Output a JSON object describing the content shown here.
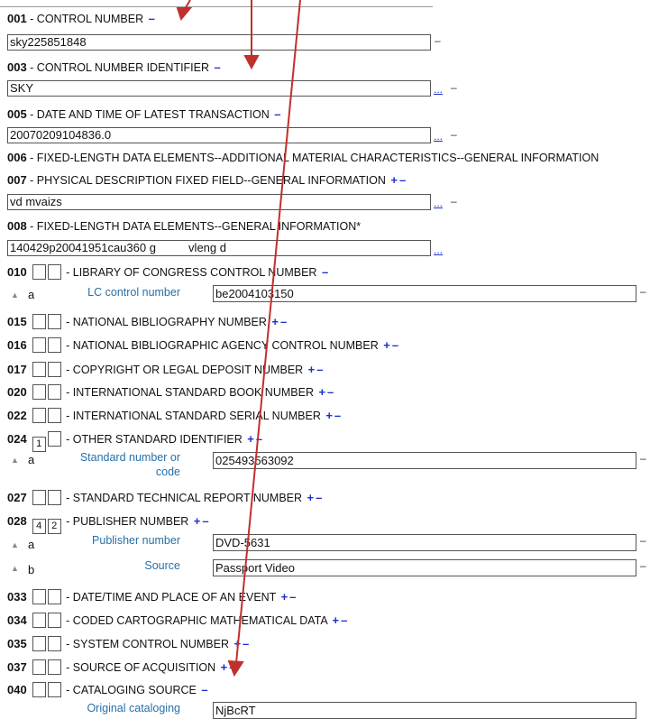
{
  "f001": {
    "tag": "001",
    "title": " - CONTROL NUMBER ",
    "minus": "–",
    "value": "sky225851848",
    "dash": "–"
  },
  "f003": {
    "tag": "003",
    "title": " - CONTROL NUMBER IDENTIFIER ",
    "minus": "–",
    "value": "SKY",
    "ellipsis": "...",
    "dash": "–"
  },
  "f005": {
    "tag": "005",
    "title": " - DATE AND TIME OF LATEST TRANSACTION ",
    "minus": "–",
    "value": "20070209104836.0",
    "ellipsis": "...",
    "dash": "–"
  },
  "f006": {
    "tag": "006",
    "title": " - FIXED-LENGTH DATA ELEMENTS--ADDITIONAL MATERIAL CHARACTERISTICS--GENERAL INFORMATION"
  },
  "f007": {
    "tag": "007",
    "title": " - PHYSICAL DESCRIPTION FIXED FIELD--GENERAL INFORMATION ",
    "plus": "+",
    "minus": "–",
    "value": "vd mvaizs",
    "ellipsis": "...",
    "dash": "–"
  },
  "f008": {
    "tag": "008",
    "title": " - FIXED-LENGTH DATA ELEMENTS--GENERAL INFORMATION*",
    "value": "140429p20041951cau360 g          vleng d",
    "ellipsis": "..."
  },
  "f010": {
    "tag": "010",
    "title": " - LIBRARY OF CONGRESS CONTROL NUMBER ",
    "minus": "–",
    "ind1": "",
    "ind2": "",
    "sub_a": {
      "arrow": "▲",
      "code": "a",
      "label": "LC control number",
      "value": "be2004103150",
      "dash": "–"
    }
  },
  "f015": {
    "tag": "015",
    "title": " - NATIONAL BIBLIOGRAPHY NUMBER ",
    "plus": "+",
    "minus": "–"
  },
  "f016": {
    "tag": "016",
    "title": " - NATIONAL BIBLIOGRAPHIC AGENCY CONTROL NUMBER ",
    "plus": "+",
    "minus": "–"
  },
  "f017": {
    "tag": "017",
    "title": " - COPYRIGHT OR LEGAL DEPOSIT NUMBER ",
    "plus": "+",
    "minus": "–"
  },
  "f020": {
    "tag": "020",
    "title": " - INTERNATIONAL STANDARD BOOK NUMBER ",
    "plus": "+",
    "minus": "–"
  },
  "f022": {
    "tag": "022",
    "title": " - INTERNATIONAL STANDARD SERIAL NUMBER ",
    "plus": "+",
    "minus": "–"
  },
  "f024": {
    "tag": "024",
    "title": " - OTHER STANDARD IDENTIFIER ",
    "plus": "+",
    "minus": "–",
    "ind1": "1",
    "ind2": "",
    "sub_a": {
      "arrow": "▲",
      "code": "a",
      "label1": "Standard number or",
      "label2": "code",
      "value": "025493563092",
      "dash": "–"
    }
  },
  "f027": {
    "tag": "027",
    "title": " - STANDARD TECHNICAL REPORT NUMBER ",
    "plus": "+",
    "minus": "–"
  },
  "f028": {
    "tag": "028",
    "title": " - PUBLISHER NUMBER ",
    "plus": "+",
    "minus": "–",
    "ind1": "4",
    "ind2": "2",
    "sub_a": {
      "arrow": "▲",
      "code": "a",
      "label": "Publisher number",
      "value": "DVD-5631",
      "dash": "–"
    },
    "sub_b": {
      "arrow": "▲",
      "code": "b",
      "label": "Source",
      "value": "Passport Video",
      "dash": "–"
    }
  },
  "f033": {
    "tag": "033",
    "title": " - DATE/TIME AND PLACE OF AN EVENT ",
    "plus": "+",
    "minus": "–"
  },
  "f034": {
    "tag": "034",
    "title": " - CODED CARTOGRAPHIC MATHEMATICAL DATA ",
    "plus": "+",
    "minus": "–"
  },
  "f035": {
    "tag": "035",
    "title": " - SYSTEM CONTROL NUMBER ",
    "plus": "+",
    "minus": "–"
  },
  "f037": {
    "tag": "037",
    "title": " - SOURCE OF ACQUISITION ",
    "plus": "+",
    "minus": "–"
  },
  "f040": {
    "tag": "040",
    "title": " - CATALOGING SOURCE ",
    "minus": "–",
    "sub_a": {
      "label": "Original cataloging",
      "value": "NjBcRT"
    }
  },
  "colors": {
    "link": "#1a2fd0",
    "label": "#2670a8",
    "arrow": "#c0302c"
  }
}
